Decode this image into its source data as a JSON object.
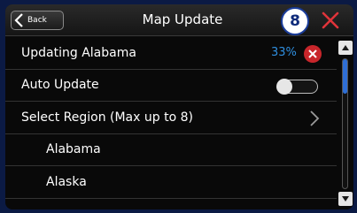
{
  "header": {
    "back_label": "Back",
    "title": "Map Update",
    "badge": "8"
  },
  "rows": {
    "updating": {
      "label": "Updating Alabama",
      "progress": "33%"
    },
    "auto_update": {
      "label": "Auto Update",
      "enabled": false
    },
    "select_region": {
      "label": "Select Region (Max up to 8)"
    },
    "regions": [
      "Alabama",
      "Alaska"
    ]
  },
  "colors": {
    "accent_blue": "#2f8fe0",
    "cancel_red": "#c8262b",
    "close_red": "#e0343a",
    "badge_blue": "#0d2a7a"
  },
  "scroll_fraction_visible": 0.27
}
